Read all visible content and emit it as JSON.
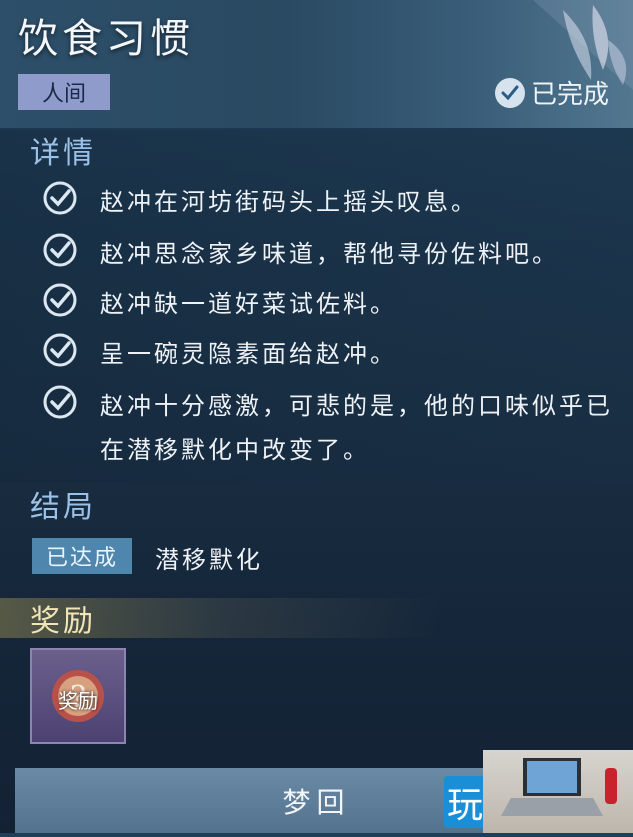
{
  "header": {
    "title": "饮食习惯",
    "realm_tag": "人间",
    "status_label": "已完成"
  },
  "details": {
    "section_title": "详情",
    "tasks": [
      {
        "text": "赵冲在河坊街码头上摇头叹息。",
        "done": true
      },
      {
        "text": "赵冲思念家乡味道，帮他寻份佐料吧。",
        "done": true
      },
      {
        "text": "赵冲缺一道好菜试佐料。",
        "done": true
      },
      {
        "text": "呈一碗灵隐素面给赵冲。",
        "done": true
      },
      {
        "text": "赵冲十分感激，可悲的是，他的口味似乎已在潜移默化中改变了。",
        "done": true
      }
    ]
  },
  "ending": {
    "section_title": "结局",
    "status_tag": "已达成",
    "name": "潜移默化"
  },
  "reward": {
    "section_title": "奖励",
    "item_label": "奖励"
  },
  "action": {
    "button_label": "梦回"
  },
  "watermark": {
    "char": "玩"
  },
  "colors": {
    "section_title": "#9bc1e6",
    "reward_title": "#f1e5b6",
    "realm_tag_bg": "#8e9bcb",
    "ending_tag_bg": "#4e86ad"
  }
}
